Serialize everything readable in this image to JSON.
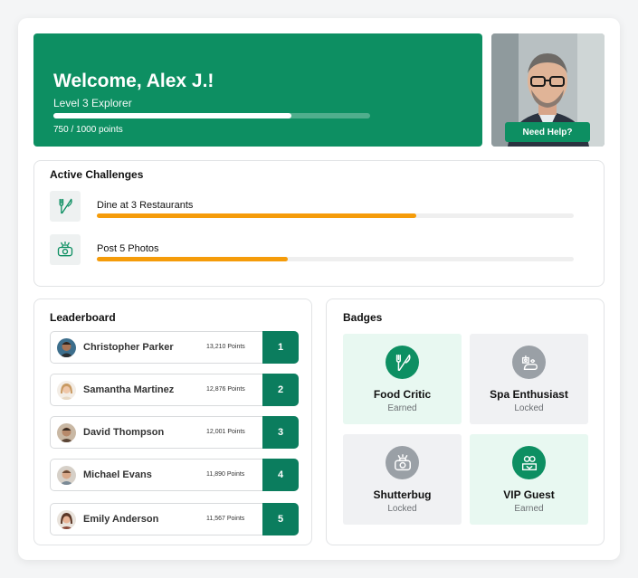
{
  "hero": {
    "title": "Welcome, Alex J.!",
    "level": "Level 3 Explorer",
    "points_text": "750 / 1000 points",
    "progress_fraction": 0.75
  },
  "help": {
    "label": "Need Help?"
  },
  "challenges": {
    "title": "Active Challenges",
    "items": [
      {
        "label": "Dine at 3 Restaurants",
        "icon": "utensils-icon",
        "progress_fraction": 0.67
      },
      {
        "label": "Post 5 Photos",
        "icon": "camera-icon",
        "progress_fraction": 0.4
      }
    ]
  },
  "leaderboard": {
    "title": "Leaderboard",
    "rows": [
      {
        "name": "Christopher Parker",
        "points": "13,210 Points",
        "rank": "1"
      },
      {
        "name": "Samantha Martinez",
        "points": "12,876 Points",
        "rank": "2"
      },
      {
        "name": "David Thompson",
        "points": "12,001 Points",
        "rank": "3"
      },
      {
        "name": "Michael Evans",
        "points": "11,890 Points",
        "rank": "4"
      },
      {
        "name": "Emily Anderson",
        "points": "11,567 Points",
        "rank": "5"
      }
    ]
  },
  "badges": {
    "title": "Badges",
    "items": [
      {
        "name": "Food Critic",
        "status": "Earned",
        "icon": "utensils-icon"
      },
      {
        "name": "Spa Enthusiast",
        "status": "Locked",
        "icon": "spa-icon"
      },
      {
        "name": "Shutterbug",
        "status": "Locked",
        "icon": "camera-icon"
      },
      {
        "name": "VIP Guest",
        "status": "Earned",
        "icon": "vip-icon"
      }
    ]
  },
  "colors": {
    "primary_green": "#0d8f62",
    "rank_green": "#0b7d5e",
    "progress_orange": "#f59c0a",
    "earned_bg": "#e8f8f1",
    "locked_bg": "#f0f1f3"
  }
}
